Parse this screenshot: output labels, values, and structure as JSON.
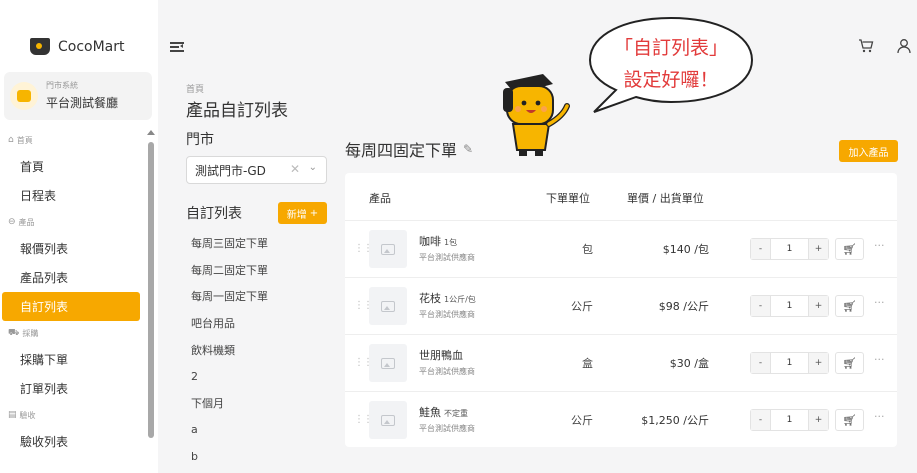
{
  "app": {
    "name": "CocoMart"
  },
  "store_card": {
    "system": "門市系統",
    "name": "平台測試餐廳"
  },
  "menu": {
    "groups": [
      {
        "label": "首頁",
        "icon": "home-icon",
        "items": [
          {
            "label": "首頁"
          },
          {
            "label": "日程表"
          }
        ]
      },
      {
        "label": "產品",
        "icon": "box-icon",
        "items": [
          {
            "label": "報價列表"
          },
          {
            "label": "產品列表"
          },
          {
            "label": "自訂列表",
            "active": true
          }
        ]
      },
      {
        "label": "採購",
        "icon": "cart-icon",
        "items": [
          {
            "label": "採購下單"
          },
          {
            "label": "訂單列表"
          }
        ]
      },
      {
        "label": "驗收",
        "icon": "clipboard-icon",
        "items": [
          {
            "label": "驗收列表"
          }
        ]
      }
    ]
  },
  "breadcrumb": "首頁",
  "page_title": "產品自訂列表",
  "store_filter": {
    "label": "門市",
    "value": "測試門市-GD"
  },
  "custom_lists": {
    "label": "自訂列表",
    "add_label": "新增",
    "items": [
      "每周三固定下單",
      "每周二固定下單",
      "每周一固定下單",
      "吧台用品",
      "飲料機類",
      "2",
      "下個月",
      "a",
      "b"
    ]
  },
  "current_list": {
    "title": "每周四固定下單",
    "add_product_label": "加入產品"
  },
  "table": {
    "headers": {
      "product": "產品",
      "order_unit": "下單單位",
      "price": "單價 / 出貨單位"
    },
    "rows": [
      {
        "name": "咖啡",
        "spec": "1包",
        "supplier": "平台測試供應商",
        "unit": "包",
        "price": "$140 /包",
        "qty": "1"
      },
      {
        "name": "花枝",
        "spec": "1公斤/包",
        "supplier": "平台測試供應商",
        "unit": "公斤",
        "price": "$98 /公斤",
        "qty": "1"
      },
      {
        "name": "世朋鴨血",
        "spec": "",
        "supplier": "平台測試供應商",
        "unit": "盒",
        "price": "$30 /盒",
        "qty": "1"
      },
      {
        "name": "鮭魚",
        "spec": "不定重",
        "supplier": "平台測試供應商",
        "unit": "公斤",
        "price": "$1,250 /公斤",
        "qty": "1"
      }
    ],
    "stepper": {
      "minus": "-",
      "plus": "+"
    }
  },
  "speech_bubble": {
    "line1": "「自訂列表」",
    "line2": "設定好囉！"
  },
  "colors": {
    "accent": "#f7a800",
    "bubble_text": "#e23b3b"
  }
}
